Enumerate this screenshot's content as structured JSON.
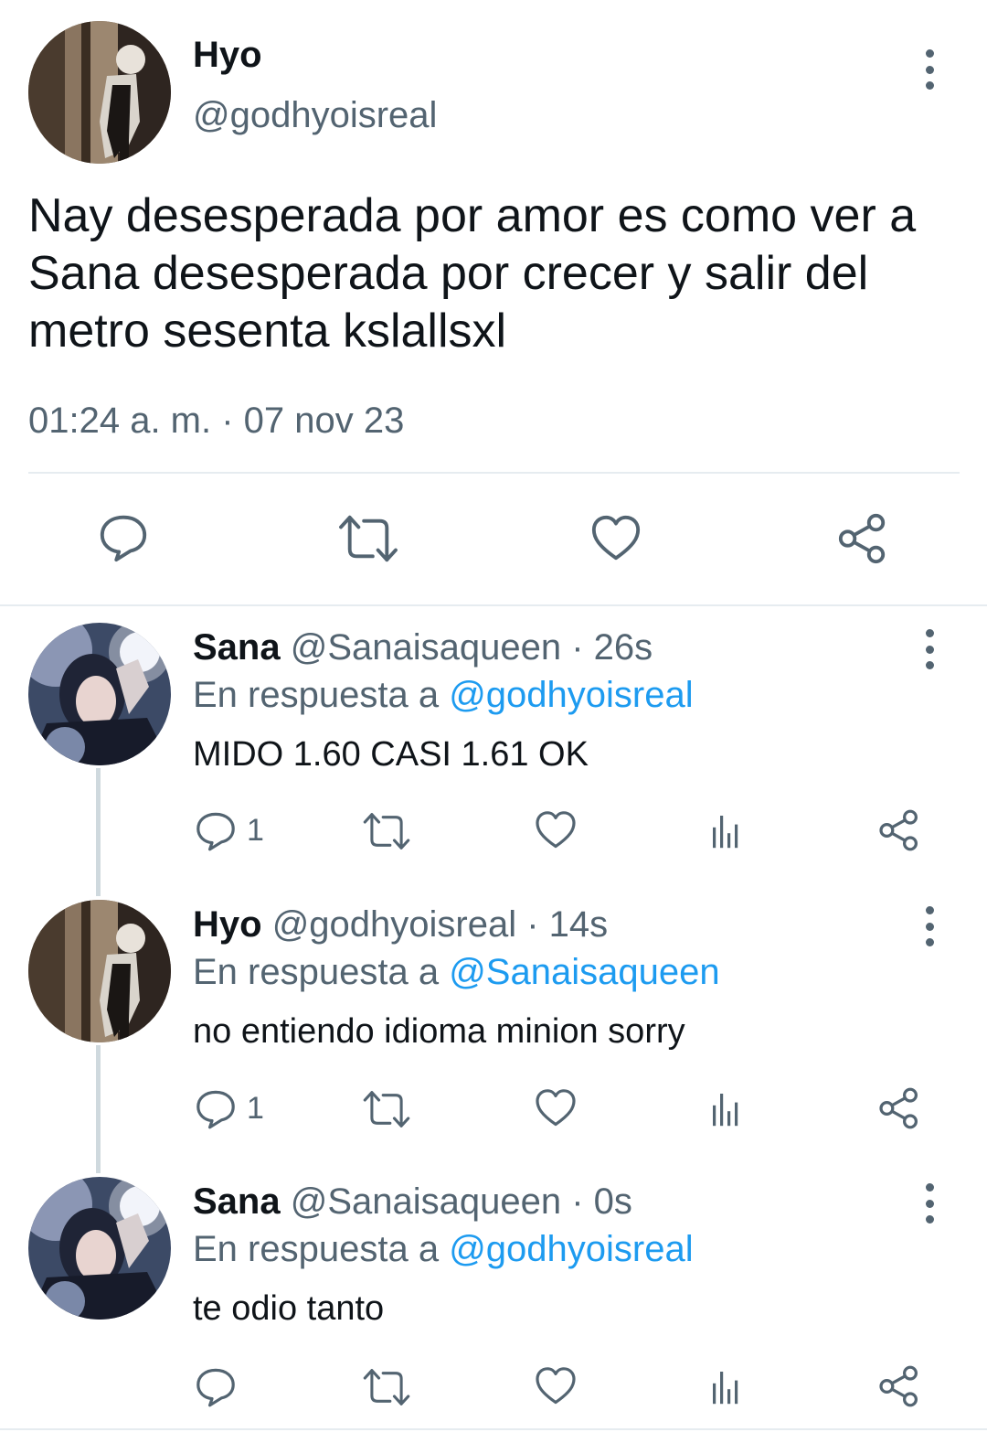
{
  "main_tweet": {
    "author_name": "Hyo",
    "handle": "@godhyoisreal",
    "text_lines": [
      "Nay desesperada por amor es como ver a",
      "Sana desesperada por crecer y salir del",
      "metro sesenta kslallsxl"
    ],
    "timestamp": "01:24 a. m. · 07 nov 23",
    "actions": [
      "reply-icon",
      "retweet-icon",
      "like-icon",
      "share-icon"
    ]
  },
  "replies": [
    {
      "author_name": "Sana",
      "handle": "@Sanaisaqueen",
      "time": "· 26s",
      "reply_prefix": "En respuesta a",
      "reply_to": "@godhyoisreal",
      "text": "MIDO 1.60 CASI 1.61 OK",
      "reply_count": "1"
    },
    {
      "author_name": "Hyo",
      "handle": "@godhyoisreal",
      "time": "· 14s",
      "reply_prefix": "En respuesta a",
      "reply_to": "@Sanaisaqueen",
      "text": "no entiendo idioma minion sorry",
      "reply_count": "1"
    },
    {
      "author_name": "Sana",
      "handle": "@Sanaisaqueen",
      "time": "· 0s",
      "reply_prefix": "En respuesta a",
      "reply_to": "@godhyoisreal",
      "text": "te odio tanto",
      "reply_count": ""
    }
  ],
  "colors": {
    "text": "#0f1419",
    "secondary": "#536471",
    "link": "#1d9bf0",
    "divider": "#e6ecf0"
  }
}
